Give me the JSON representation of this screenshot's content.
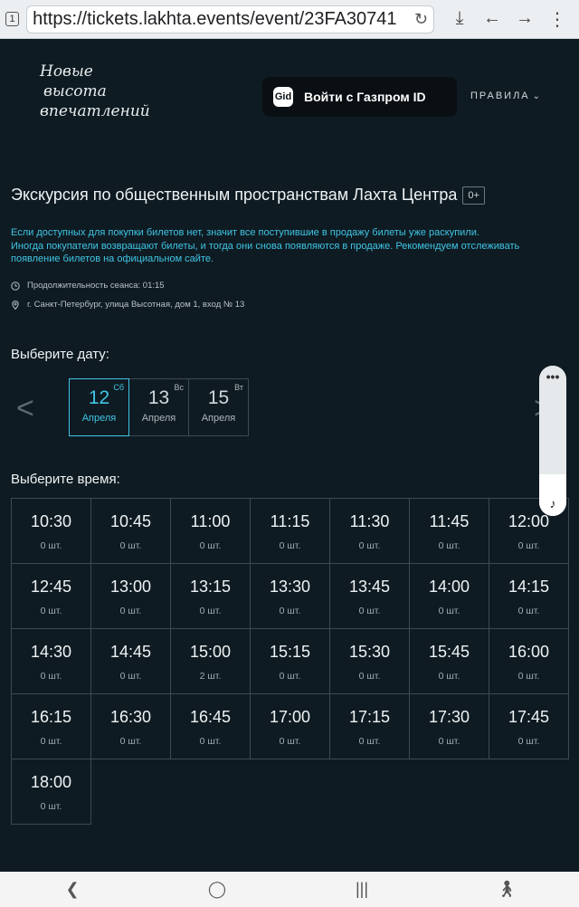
{
  "browser": {
    "tab_count": "1",
    "url": "https://tickets.lakhta.events/event/23FA30741",
    "reload_icon": "reload-icon",
    "download_icon": "download-icon",
    "back_icon": "back-arrow-icon",
    "forward_icon": "forward-arrow-icon"
  },
  "header": {
    "logo_lines": [
      "Новые",
      "высота",
      "впечатлений"
    ],
    "login_button": "Войти с Газпром ID",
    "login_icon_text": "Gid",
    "rules": "ПРАВИЛА"
  },
  "event": {
    "title": "Экскурсия по общественным пространствам Лахта Центра",
    "age": "0+",
    "notice_lines": [
      "Если доступных для покупки билетов нет, значит все поступившие в продажу билеты уже раскупили.",
      "Иногда покупатели возвращают билеты, и тогда они снова появляются в продаже. Рекомендуем отслеживать",
      "появление билетов на официальном сайте."
    ],
    "duration": "Продолжительность сеанса: 01:15",
    "address": "г. Санкт-Петербург, улица Высотная, дом 1, вход № 13"
  },
  "dates": {
    "label": "Выберите дату:",
    "items": [
      {
        "day": "12",
        "dow": "Сб",
        "month": "Апреля",
        "selected": true
      },
      {
        "day": "13",
        "dow": "Вс",
        "month": "Апреля",
        "selected": false
      },
      {
        "day": "15",
        "dow": "Вт",
        "month": "Апреля",
        "selected": false
      }
    ]
  },
  "times": {
    "label": "Выберите время:",
    "slots": [
      {
        "time": "10:30",
        "count": "0 шт."
      },
      {
        "time": "10:45",
        "count": "0 шт."
      },
      {
        "time": "11:00",
        "count": "0 шт."
      },
      {
        "time": "11:15",
        "count": "0 шт."
      },
      {
        "time": "11:30",
        "count": "0 шт."
      },
      {
        "time": "11:45",
        "count": "0 шт."
      },
      {
        "time": "12:00",
        "count": "0 шт."
      },
      {
        "time": "12:45",
        "count": "0 шт."
      },
      {
        "time": "13:00",
        "count": "0 шт."
      },
      {
        "time": "13:15",
        "count": "0 шт."
      },
      {
        "time": "13:30",
        "count": "0 шт."
      },
      {
        "time": "13:45",
        "count": "0 шт."
      },
      {
        "time": "14:00",
        "count": "0 шт."
      },
      {
        "time": "14:15",
        "count": "0 шт."
      },
      {
        "time": "14:30",
        "count": "0 шт."
      },
      {
        "time": "14:45",
        "count": "0 шт."
      },
      {
        "time": "15:00",
        "count": "2 шт."
      },
      {
        "time": "15:15",
        "count": "0 шт."
      },
      {
        "time": "15:30",
        "count": "0 шт."
      },
      {
        "time": "15:45",
        "count": "0 шт."
      },
      {
        "time": "16:00",
        "count": "0 шт."
      },
      {
        "time": "16:15",
        "count": "0 шт."
      },
      {
        "time": "16:30",
        "count": "0 шт."
      },
      {
        "time": "16:45",
        "count": "0 шт."
      },
      {
        "time": "17:00",
        "count": "0 шт."
      },
      {
        "time": "17:15",
        "count": "0 шт."
      },
      {
        "time": "17:30",
        "count": "0 шт."
      },
      {
        "time": "17:45",
        "count": "0 шт."
      },
      {
        "time": "18:00",
        "count": "0 шт."
      }
    ]
  },
  "colors": {
    "background": "#0f1b22",
    "accent": "#3fc6e6",
    "border": "#3d4a52"
  }
}
